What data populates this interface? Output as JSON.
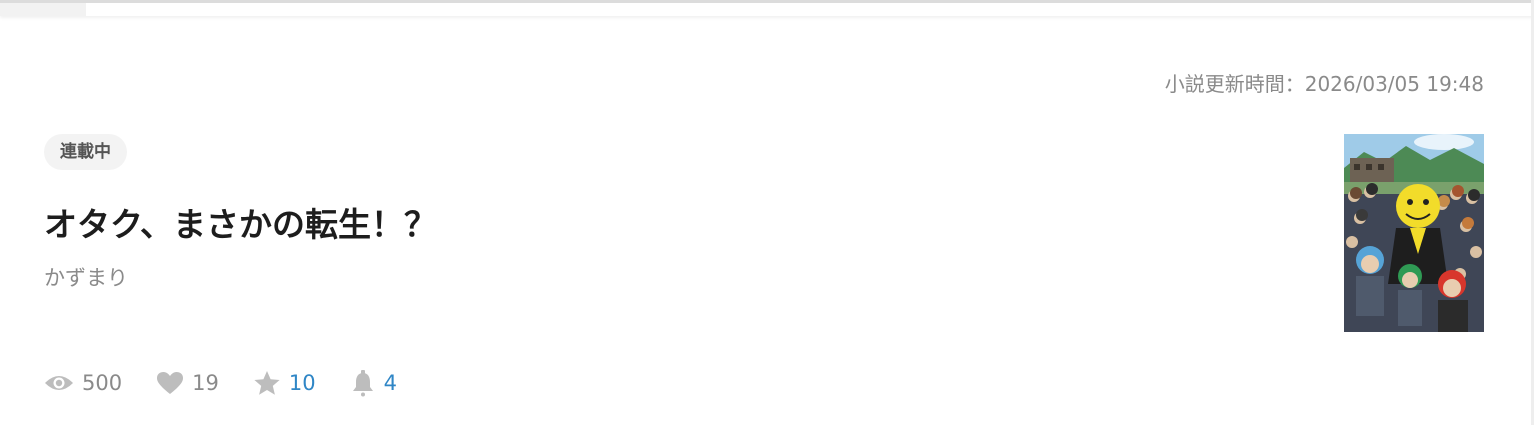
{
  "novel": {
    "updated_text": "小説更新時間：2026/03/05 19:48",
    "status": "連載中",
    "title": "オタク、まさかの転生！？",
    "author": "かずまり"
  },
  "stats": {
    "views": "500",
    "likes": "19",
    "stars": "10",
    "bookmarks": "4"
  },
  "icons": {
    "views": "eye-icon",
    "likes": "heart-icon",
    "stars": "star-icon",
    "bookmarks": "bell-icon"
  },
  "colors": {
    "link_blue": "#2f86c6",
    "muted_gray": "#8a8a8a",
    "title_black": "#1d1d1d",
    "badge_bg": "#f3f3f3"
  }
}
